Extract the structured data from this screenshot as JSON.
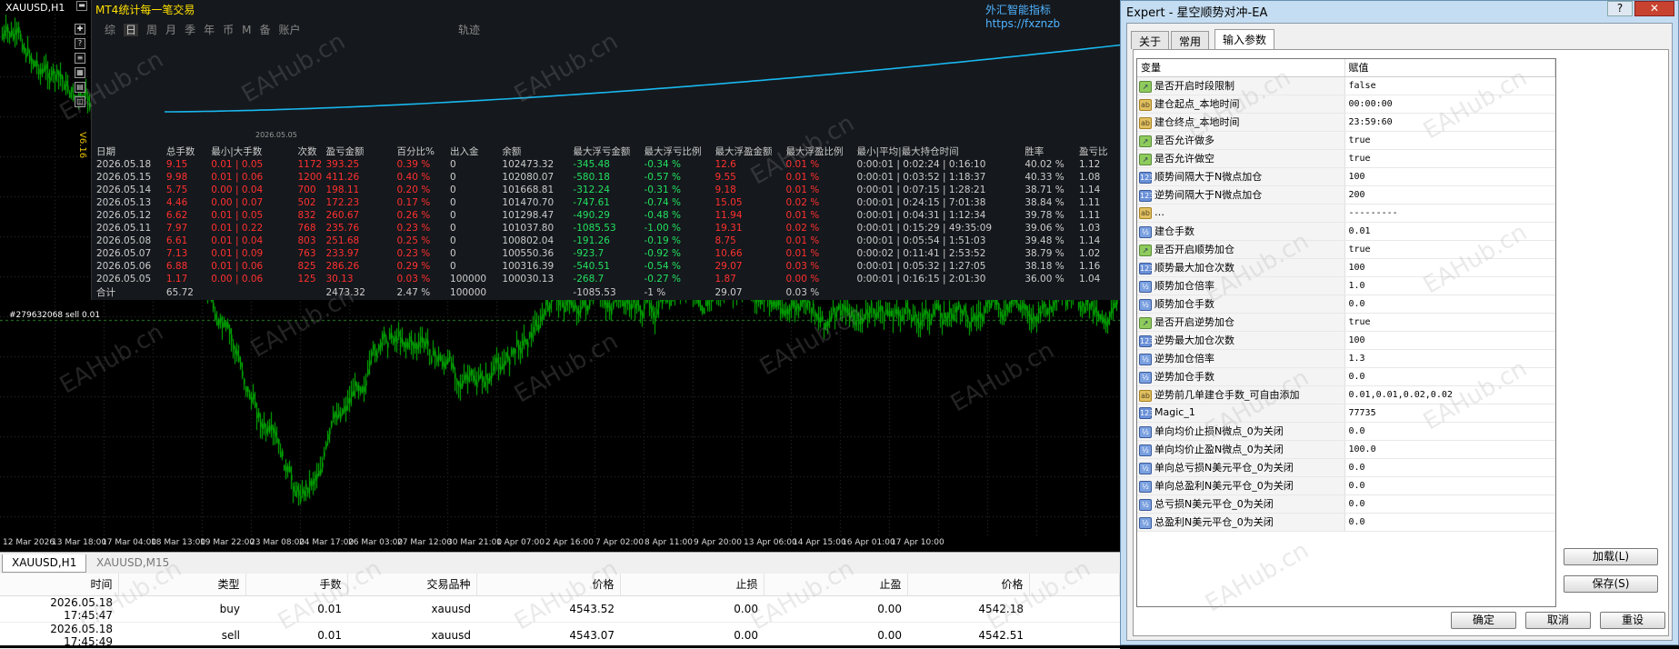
{
  "chart": {
    "symbol": "XAUUSD,H1",
    "ea_version": "V6.16",
    "indicator_title": "外汇智能指标 https://fxznzb",
    "price_line_label": "#279632068 sell 0.01",
    "x_ticks": [
      "12 Mar 2026",
      "13 Mar 18:00",
      "17 Mar 04:00",
      "18 Mar 13:00",
      "19 Mar 22:00",
      "23 Mar 08:00",
      "24 Mar 17:00",
      "26 Mar 03:00",
      "27 Mar 12:00",
      "30 Mar 21:00",
      "1 Apr 07:00",
      "2 Apr 16:00",
      "7 Apr 02:00",
      "8 Apr 11:00",
      "9 Apr 20:00",
      "13 Apr 06:00",
      "14 Apr 15:00",
      "16 Apr 01:00",
      "17 Apr 10:00"
    ]
  },
  "panel": {
    "title": "MT4统计每一笔交易",
    "tabs": [
      "综",
      "日",
      "周",
      "月",
      "季",
      "年",
      "币",
      "M",
      "备",
      "账户"
    ],
    "active_tab": "日",
    "track_label": "轨迹",
    "curve_date": "2026.05.05",
    "headers": [
      "日期",
      "总手数",
      "最小|大手数",
      "次数",
      "盈亏金额",
      "百分比%",
      "出入金",
      "余额",
      "最大浮亏金额",
      "最大浮亏比例",
      "最大浮盈金额",
      "最大浮盈比例",
      "最小|平均|最大持仓时间",
      "胜率",
      "盈亏比"
    ],
    "rows": [
      [
        "2026.05.18",
        "9.15",
        "0.01 | 0.05",
        "1172",
        "393.25",
        "0.39 %",
        "0",
        "102473.32",
        "-345.48",
        "-0.34 %",
        "12.6",
        "0.01 %",
        "0:00:01 | 0:02:24 | 0:16:10",
        "40.02 %",
        "1.12"
      ],
      [
        "2026.05.15",
        "9.98",
        "0.01 | 0.06",
        "1200",
        "411.26",
        "0.40 %",
        "0",
        "102080.07",
        "-580.18",
        "-0.57 %",
        "9.55",
        "0.01 %",
        "0:00:01 | 0:03:52 | 1:18:37",
        "40.33 %",
        "1.08"
      ],
      [
        "2026.05.14",
        "5.75",
        "0.00 | 0.04",
        "700",
        "198.11",
        "0.20 %",
        "0",
        "101668.81",
        "-312.24",
        "-0.31 %",
        "9.18",
        "0.01 %",
        "0:00:01 | 0:07:15 | 1:28:21",
        "38.71 %",
        "1.14"
      ],
      [
        "2026.05.13",
        "4.46",
        "0.00 | 0.07",
        "502",
        "172.23",
        "0.17 %",
        "0",
        "101470.70",
        "-747.61",
        "-0.74 %",
        "15.05",
        "0.02 %",
        "0:00:01 | 0:24:15 | 7:01:38",
        "38.84 %",
        "1.11"
      ],
      [
        "2026.05.12",
        "6.62",
        "0.01 | 0.05",
        "832",
        "260.67",
        "0.26 %",
        "0",
        "101298.47",
        "-490.29",
        "-0.48 %",
        "11.94",
        "0.01 %",
        "0:00:01 | 0:04:31 | 1:12:34",
        "39.78 %",
        "1.11"
      ],
      [
        "2026.05.11",
        "7.97",
        "0.01 | 0.22",
        "768",
        "235.76",
        "0.23 %",
        "0",
        "101037.80",
        "-1085.53",
        "-1.00 %",
        "19.31",
        "0.02 %",
        "0:00:01 | 0:15:29 | 49:35:09",
        "39.06 %",
        "1.03"
      ],
      [
        "2026.05.08",
        "6.61",
        "0.01 | 0.04",
        "803",
        "251.68",
        "0.25 %",
        "0",
        "100802.04",
        "-191.26",
        "-0.19 %",
        "8.75",
        "0.01 %",
        "0:00:01 | 0:05:54 | 1:51:03",
        "39.48 %",
        "1.14"
      ],
      [
        "2026.05.07",
        "7.13",
        "0.01 | 0.09",
        "763",
        "233.97",
        "0.23 %",
        "0",
        "100550.36",
        "-923.7",
        "-0.92 %",
        "10.66",
        "0.01 %",
        "0:00:02 | 0:11:41 | 2:53:52",
        "38.79 %",
        "1.02"
      ],
      [
        "2026.05.06",
        "6.88",
        "0.01 | 0.06",
        "825",
        "286.26",
        "0.29 %",
        "0",
        "100316.39",
        "-540.51",
        "-0.54 %",
        "29.07",
        "0.03 %",
        "0:00:01 | 0:05:32 | 1:27:05",
        "38.18 %",
        "1.16"
      ],
      [
        "2026.05.05",
        "1.17",
        "0.00 | 0.06",
        "125",
        "30.13",
        "0.03 %",
        "100000",
        "100030.13",
        "-268.7",
        "-0.27 %",
        "1.87",
        "0.00 %",
        "0:00:01 | 0:16:15 | 2:01:30",
        "36.00 %",
        "1.04"
      ]
    ],
    "total": [
      "合计",
      "65.72",
      "",
      "",
      "2473.32",
      "2.47 %",
      "100000",
      "",
      "-1085.53",
      "-1 %",
      "29.07",
      "0.03 %",
      "",
      "",
      ""
    ]
  },
  "chart_tabs": [
    "XAUUSD,H1",
    "XAUUSD,M15"
  ],
  "trades": {
    "headers": [
      "时间",
      "类型",
      "手数",
      "交易品种",
      "价格",
      "止损",
      "止盈",
      "价格"
    ],
    "rows": [
      [
        "2026.05.18 17:45:47",
        "buy",
        "0.01",
        "xauusd",
        "4543.52",
        "0.00",
        "0.00",
        "4542.18"
      ],
      [
        "2026.05.18 17:45:49",
        "sell",
        "0.01",
        "xauusd",
        "4543.07",
        "0.00",
        "0.00",
        "4542.51"
      ]
    ]
  },
  "dialog": {
    "title": "Expert - 星空顺势对冲-EA",
    "help": "?",
    "close": "✕",
    "tabs": [
      "关于",
      "常用",
      "输入参数"
    ],
    "active_tab": "输入参数",
    "col_var": "变量",
    "col_val": "赋值",
    "params": [
      {
        "t": "bool",
        "n": "是否开启时段限制",
        "v": "false"
      },
      {
        "t": "str",
        "n": "建仓起点_本地时间",
        "v": "00:00:00"
      },
      {
        "t": "str",
        "n": "建仓终点_本地时间",
        "v": "23:59:60"
      },
      {
        "t": "bool",
        "n": "是否允许做多",
        "v": "true"
      },
      {
        "t": "bool",
        "n": "是否允许做空",
        "v": "true"
      },
      {
        "t": "int",
        "n": "顺势间隔大于N微点加仓",
        "v": "100"
      },
      {
        "t": "int",
        "n": "逆势间隔大于N微点加仓",
        "v": "200"
      },
      {
        "t": "str",
        "n": "…",
        "v": "---------"
      },
      {
        "t": "dbl",
        "n": "建仓手数",
        "v": "0.01"
      },
      {
        "t": "bool",
        "n": "是否开启顺势加仓",
        "v": "true"
      },
      {
        "t": "int",
        "n": "顺势最大加仓次数",
        "v": "100"
      },
      {
        "t": "dbl",
        "n": "顺势加仓倍率",
        "v": "1.0"
      },
      {
        "t": "dbl",
        "n": "顺势加仓手数",
        "v": "0.0"
      },
      {
        "t": "bool",
        "n": "是否开启逆势加仓",
        "v": "true"
      },
      {
        "t": "int",
        "n": "逆势最大加仓次数",
        "v": "100"
      },
      {
        "t": "dbl",
        "n": "逆势加仓倍率",
        "v": "1.3"
      },
      {
        "t": "dbl",
        "n": "逆势加仓手数",
        "v": "0.0"
      },
      {
        "t": "str",
        "n": "逆势前几单建仓手数_可自由添加",
        "v": "0.01,0.01,0.02,0.02"
      },
      {
        "t": "int",
        "n": "Magic_1",
        "v": "77735"
      },
      {
        "t": "dbl",
        "n": "单向均价止损N微点_0为关闭",
        "v": "0.0"
      },
      {
        "t": "dbl",
        "n": "单向均价止盈N微点_0为关闭",
        "v": "100.0"
      },
      {
        "t": "dbl",
        "n": "单向总亏损N美元平仓_0为关闭",
        "v": "0.0"
      },
      {
        "t": "dbl",
        "n": "单向总盈利N美元平仓_0为关闭",
        "v": "0.0"
      },
      {
        "t": "dbl",
        "n": "总亏损N美元平仓_0为关闭",
        "v": "0.0"
      },
      {
        "t": "dbl",
        "n": "总盈利N美元平仓_0为关闭",
        "v": "0.0"
      }
    ],
    "icons": {
      "bool": "↗",
      "str": "ab",
      "int": "123",
      "dbl": "½"
    },
    "load_btn": "加载(L)",
    "save_btn": "保存(S)",
    "ok_btn": "确定",
    "cancel_btn": "取消",
    "reset_btn": "重设"
  },
  "watermark": "EAHub.cn",
  "colors": {
    "candle": "#00c000",
    "curve": "#19b8f0",
    "loss": "#ff3030",
    "gain": "#22e060"
  }
}
